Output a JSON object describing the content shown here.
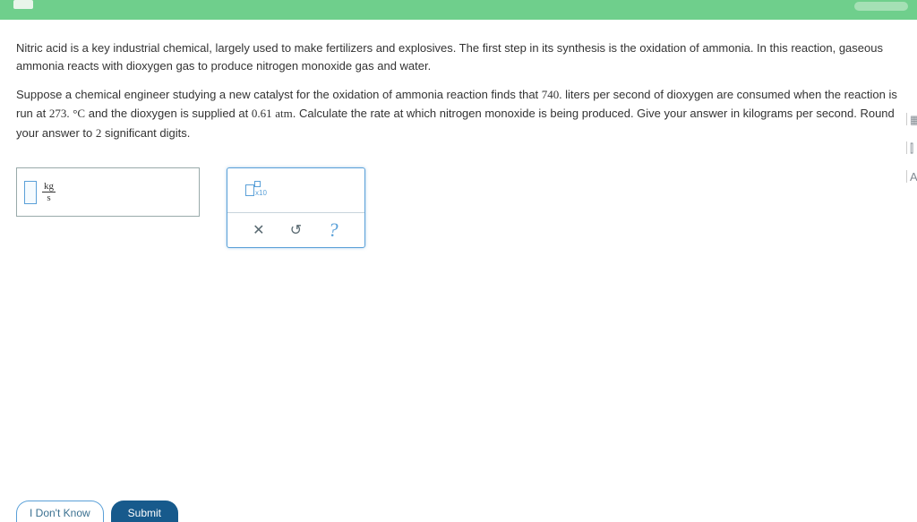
{
  "question": {
    "intro": "Nitric acid is a key industrial chemical, largely used to make fertilizers and explosives. The first step in its synthesis is the oxidation of ammonia. In this reaction, gaseous ammonia reacts with dioxygen gas to produce nitrogen monoxide gas and water.",
    "part_a": "Suppose a chemical engineer studying a new catalyst for the oxidation of ammonia reaction finds that ",
    "val1": "740.",
    "part_b": " liters per second of dioxygen are consumed when the reaction is run at ",
    "val2": "273.",
    "val2_unit": "°C",
    "part_c": " and the dioxygen is supplied at ",
    "val3": "0.61",
    "val3_unit": "atm",
    "part_d": ". Calculate the rate at which nitrogen monoxide is being produced. Give your answer in kilograms per second. Round your answer to ",
    "val4": "2",
    "part_e": " significant digits."
  },
  "answer_unit": {
    "numerator": "kg",
    "denominator": "s"
  },
  "toolbar": {
    "sci_base": "x10",
    "clear": "✕",
    "reset": "↺",
    "help": "?"
  },
  "side": {
    "calc": "▦",
    "chart": "⫿",
    "text": "A"
  },
  "buttons": {
    "idk": "I Don't Know",
    "submit": "Submit"
  }
}
